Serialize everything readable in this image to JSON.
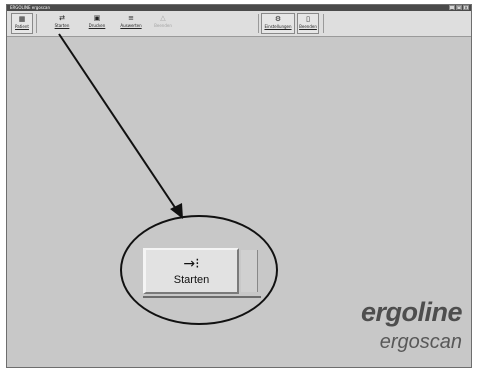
{
  "window": {
    "title": "ERGOLINE  ergoscan",
    "controls": [
      "_",
      "□",
      "×"
    ]
  },
  "toolbar": {
    "buttons": [
      {
        "label": "Patient",
        "icon": "patient-icon",
        "glyph": "▦"
      },
      {
        "label": "Starten",
        "icon": "start-icon",
        "glyph": "⇄"
      },
      {
        "label": "Drucken",
        "icon": "save-disk-icon",
        "glyph": "▣"
      },
      {
        "label": "Auswerten",
        "icon": "evaluate-icon",
        "glyph": "≡"
      },
      {
        "label": "Beenden",
        "icon": "exit-icon",
        "glyph": "△"
      },
      {
        "label": "Einstellungen",
        "icon": "settings-icon",
        "glyph": "⚙"
      },
      {
        "label": "Beenden",
        "icon": "door-exit-icon",
        "glyph": "▯"
      }
    ]
  },
  "callout": {
    "label": "Starten",
    "icon": "start-measurement-icon",
    "glyph": "→⁝"
  },
  "brand": {
    "logo": "ergoline",
    "product": "ergoscan"
  },
  "colors": {
    "background": "#c8c8c8",
    "toolbar": "#dedede",
    "titlebar": "#4a4a4a",
    "brand": "#4e4e4e"
  }
}
